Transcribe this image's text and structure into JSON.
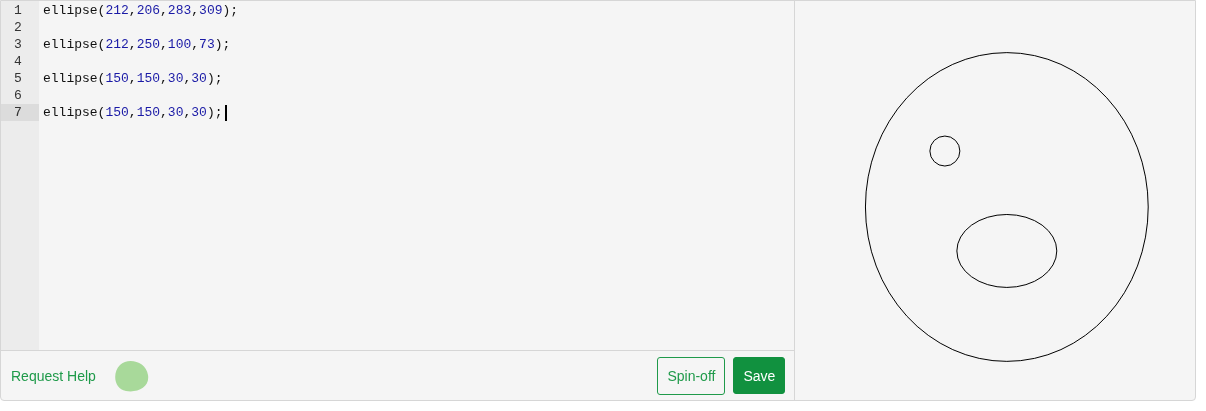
{
  "editor": {
    "lines": [
      {
        "number": "1",
        "selected": false,
        "tokens": [
          {
            "kind": "plain",
            "text": "ellipse("
          },
          {
            "kind": "number",
            "text": "212"
          },
          {
            "kind": "plain",
            "text": ","
          },
          {
            "kind": "number",
            "text": "206"
          },
          {
            "kind": "plain",
            "text": ","
          },
          {
            "kind": "number",
            "text": "283"
          },
          {
            "kind": "plain",
            "text": ","
          },
          {
            "kind": "number",
            "text": "309"
          },
          {
            "kind": "plain",
            "text": ");"
          }
        ]
      },
      {
        "number": "2",
        "selected": false
      },
      {
        "number": "3",
        "selected": false,
        "tokens": [
          {
            "kind": "plain",
            "text": "ellipse("
          },
          {
            "kind": "number",
            "text": "212"
          },
          {
            "kind": "plain",
            "text": ","
          },
          {
            "kind": "number",
            "text": "250"
          },
          {
            "kind": "plain",
            "text": ","
          },
          {
            "kind": "number",
            "text": "100"
          },
          {
            "kind": "plain",
            "text": ","
          },
          {
            "kind": "number",
            "text": "73"
          },
          {
            "kind": "plain",
            "text": ");"
          }
        ]
      },
      {
        "number": "4",
        "selected": false
      },
      {
        "number": "5",
        "selected": false,
        "tokens": [
          {
            "kind": "plain",
            "text": "ellipse("
          },
          {
            "kind": "number",
            "text": "150"
          },
          {
            "kind": "plain",
            "text": ","
          },
          {
            "kind": "number",
            "text": "150"
          },
          {
            "kind": "plain",
            "text": ","
          },
          {
            "kind": "number",
            "text": "30"
          },
          {
            "kind": "plain",
            "text": ","
          },
          {
            "kind": "number",
            "text": "30"
          },
          {
            "kind": "plain",
            "text": ");"
          }
        ]
      },
      {
        "number": "6",
        "selected": false
      },
      {
        "number": "7",
        "selected": true,
        "tokens": [
          {
            "kind": "plain",
            "text": "ellipse("
          },
          {
            "kind": "number",
            "text": "150"
          },
          {
            "kind": "plain",
            "text": ","
          },
          {
            "kind": "number",
            "text": "150"
          },
          {
            "kind": "plain",
            "text": ","
          },
          {
            "kind": "number",
            "text": "30"
          },
          {
            "kind": "plain",
            "text": ","
          },
          {
            "kind": "number",
            "text": "30"
          },
          {
            "kind": "plain",
            "text": ");"
          }
        ]
      }
    ]
  },
  "footer": {
    "help_link": "Request Help",
    "buttons": [
      {
        "label": "Spin-off",
        "kind": "outline"
      },
      {
        "label": "Save",
        "kind": "primary"
      }
    ]
  }
}
